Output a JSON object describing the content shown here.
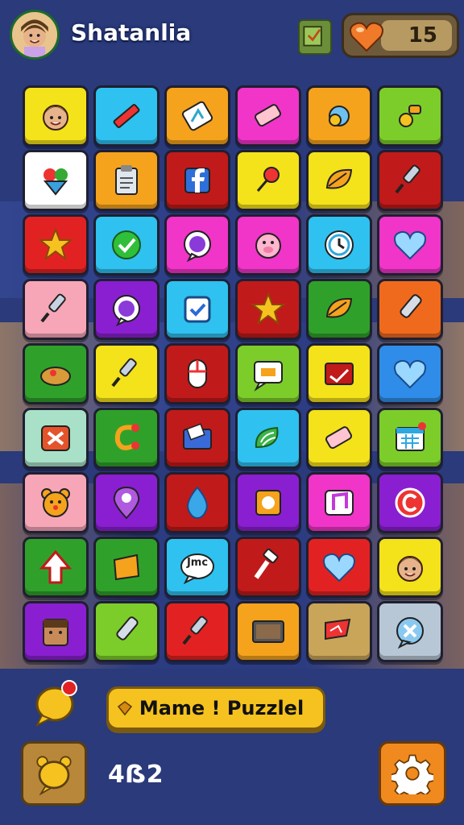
{
  "header": {
    "player_name": "Shatanlia",
    "lives_count": "15"
  },
  "grid": {
    "tiles": [
      {
        "icon": "face-icon",
        "color": "#f4e21a"
      },
      {
        "icon": "pencil-icon",
        "color": "#2fc1ef"
      },
      {
        "icon": "tag-icon",
        "color": "#f5a21d"
      },
      {
        "icon": "eraser-icon",
        "color": "#f035c8"
      },
      {
        "icon": "pacifier-icon",
        "color": "#f5a21d"
      },
      {
        "icon": "rattle-icon",
        "color": "#7ccd2a"
      },
      {
        "icon": "flower-icon",
        "color": "#ffffff"
      },
      {
        "icon": "clipboard-icon",
        "color": "#f5a21d"
      },
      {
        "icon": "facebook-icon",
        "color": "#c11a1a"
      },
      {
        "icon": "pin-icon",
        "color": "#f4e21a"
      },
      {
        "icon": "leaf-icon",
        "color": "#f4e21a"
      },
      {
        "icon": "brush-icon",
        "color": "#c11a1a"
      },
      {
        "icon": "star-icon",
        "color": "#e22222"
      },
      {
        "icon": "check-icon",
        "color": "#2fc1ef"
      },
      {
        "icon": "chat-icon",
        "color": "#f035c8"
      },
      {
        "icon": "pig-icon",
        "color": "#f035c8"
      },
      {
        "icon": "clock-icon",
        "color": "#2fc1ef"
      },
      {
        "icon": "heart-icon",
        "color": "#f035c8"
      },
      {
        "icon": "brush-icon",
        "color": "#f7a6b8"
      },
      {
        "icon": "chat-icon",
        "color": "#8a1fd1"
      },
      {
        "icon": "checkbox-icon",
        "color": "#2fc1ef"
      },
      {
        "icon": "star-icon",
        "color": "#c11a1a"
      },
      {
        "icon": "leaf-icon",
        "color": "#2fa12a"
      },
      {
        "icon": "marker-icon",
        "color": "#f06a1e"
      },
      {
        "icon": "bread-icon",
        "color": "#2fa12a"
      },
      {
        "icon": "brush-icon",
        "color": "#f4e21a"
      },
      {
        "icon": "mouse-icon",
        "color": "#c11a1a"
      },
      {
        "icon": "speech-icon",
        "color": "#7ccd2a"
      },
      {
        "icon": "mail-icon",
        "color": "#f4e21a"
      },
      {
        "icon": "heart-icon",
        "color": "#2f8ce8"
      },
      {
        "icon": "cross-icon",
        "color": "#a9e0c8"
      },
      {
        "icon": "hook-icon",
        "color": "#2fa12a"
      },
      {
        "icon": "envelope-icon",
        "color": "#c11a1a"
      },
      {
        "icon": "wifi-icon",
        "color": "#2fc1ef"
      },
      {
        "icon": "eraser-icon",
        "color": "#f4e21a"
      },
      {
        "icon": "calendar-icon",
        "color": "#7ccd2a"
      },
      {
        "icon": "teddy-icon",
        "color": "#f7a6b8"
      },
      {
        "icon": "location-icon",
        "color": "#8a1fd1"
      },
      {
        "icon": "drop-icon",
        "color": "#c11a1a"
      },
      {
        "icon": "square-icon",
        "color": "#8a1fd1"
      },
      {
        "icon": "music-icon",
        "color": "#f035c8"
      },
      {
        "icon": "copyright-icon",
        "color": "#8a1fd1"
      },
      {
        "icon": "arrow-up-icon",
        "color": "#2fa12a"
      },
      {
        "icon": "shape-icon",
        "color": "#2fa12a"
      },
      {
        "icon": "text-bubble-icon",
        "color": "#2fc1ef",
        "text": "Jmc"
      },
      {
        "icon": "hammer-icon",
        "color": "#c11a1a"
      },
      {
        "icon": "heart-icon",
        "color": "#e22222"
      },
      {
        "icon": "face-icon",
        "color": "#f4e21a"
      },
      {
        "icon": "character-icon",
        "color": "#8a1fd1"
      },
      {
        "icon": "marker-icon",
        "color": "#7ccd2a"
      },
      {
        "icon": "brush-icon",
        "color": "#e22222"
      },
      {
        "icon": "monitor-icon",
        "color": "#f5a21d"
      },
      {
        "icon": "flag-icon",
        "color": "#c9a55a"
      },
      {
        "icon": "chat-x-icon",
        "color": "#b8c7d6"
      }
    ]
  },
  "footer": {
    "title_label": "Mame ! Puzzlel",
    "score_text": "4ẞ2",
    "hint_icon": "bell-icon",
    "settings_icon": "gear-icon"
  }
}
